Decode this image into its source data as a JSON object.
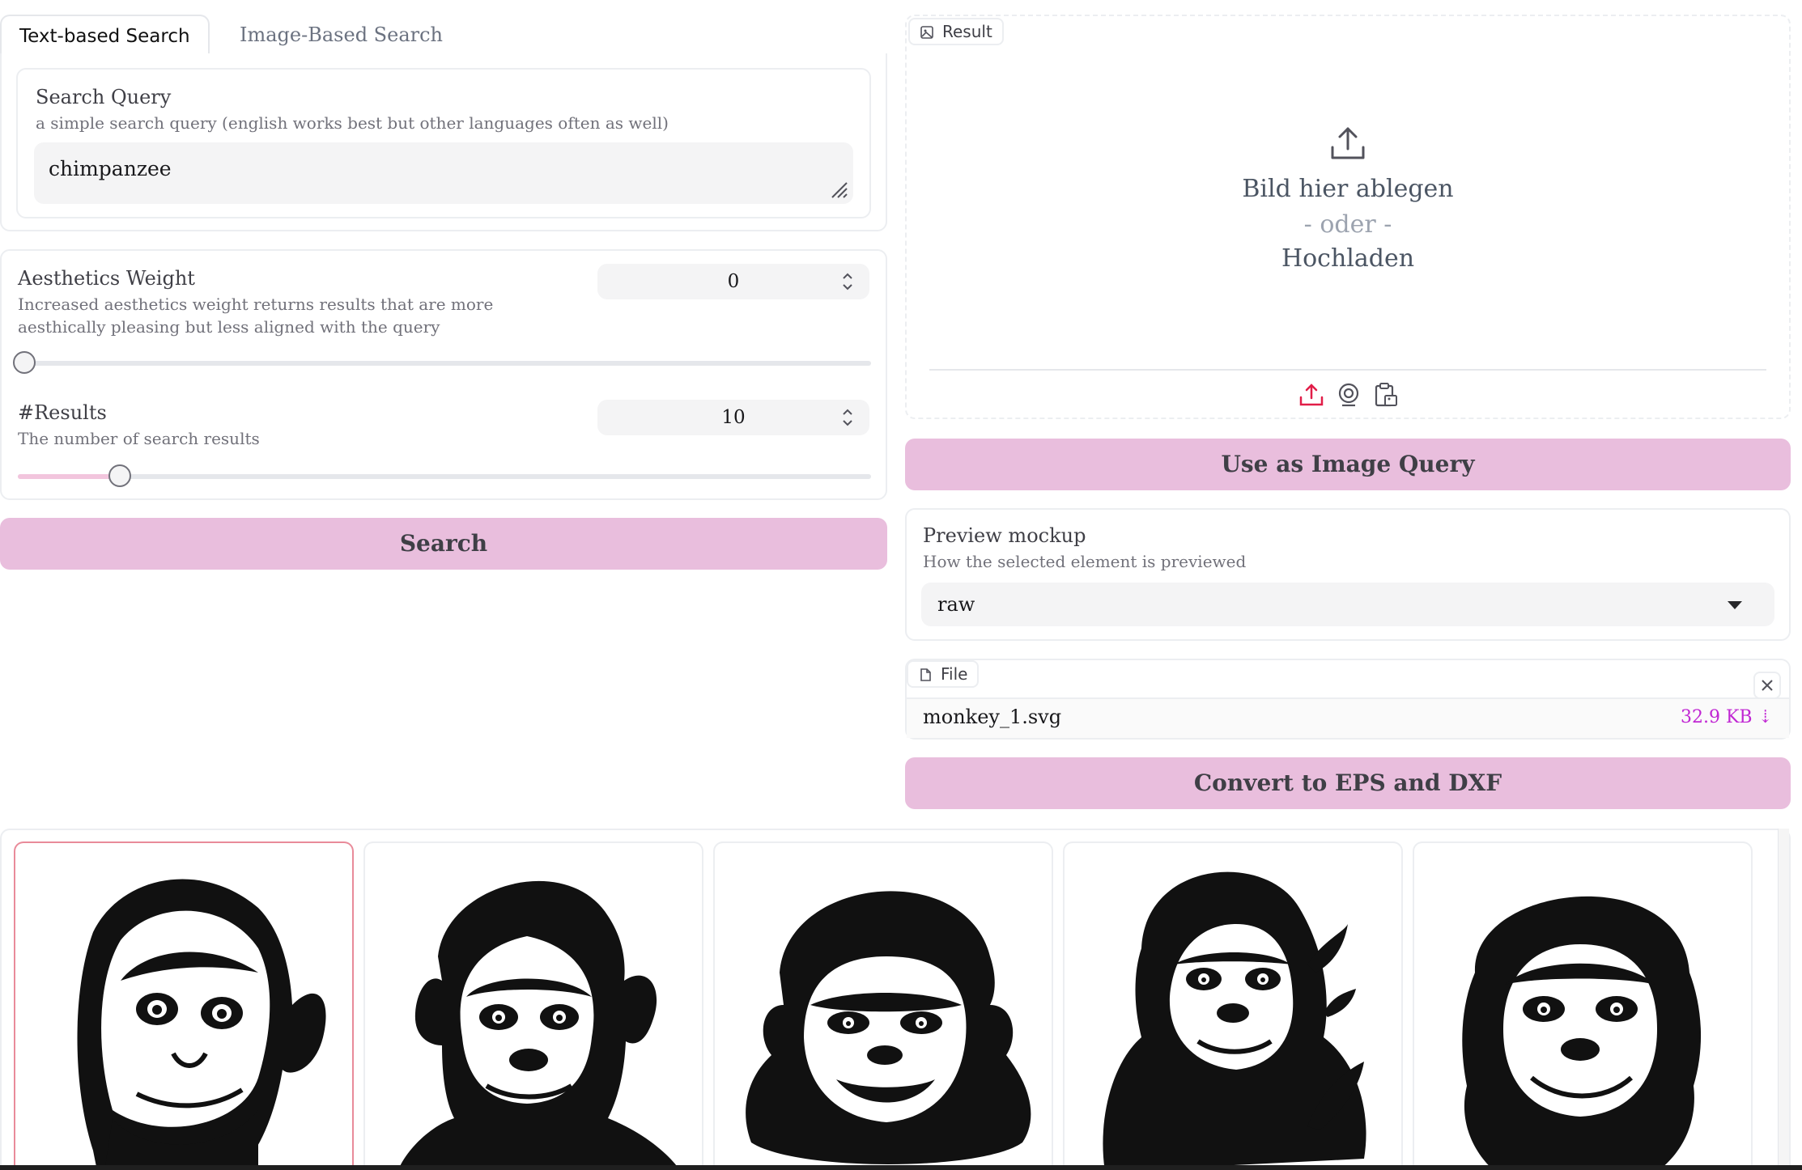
{
  "tabs": [
    {
      "label": "Text-based Search",
      "active": true
    },
    {
      "label": "Image-Based Search",
      "active": false
    }
  ],
  "search_query": {
    "label": "Search Query",
    "info": "a simple search query (english works best but other languages often as well)",
    "value": "chimpanzee"
  },
  "aesthetics": {
    "label": "Aesthetics Weight",
    "info": "Increased aesthetics weight returns results that are more aesthically pleasing but less aligned with the query",
    "value": "0",
    "fraction": 0.0
  },
  "results": {
    "label": "#Results",
    "info": "The number of search results",
    "value": "10",
    "fraction": 0.12
  },
  "search_button": {
    "label": "Search"
  },
  "result_upload": {
    "label": "Result",
    "drop_line1": "Bild hier ablegen",
    "drop_or": "- oder -",
    "drop_line2": "Hochladen",
    "sources": [
      "upload-icon",
      "webcam-icon",
      "clipboard-icon"
    ]
  },
  "image_query_button": {
    "label": "Use as Image Query"
  },
  "preview": {
    "label": "Preview mockup",
    "info": "How the selected element is previewed",
    "value": "raw"
  },
  "file": {
    "label": "File",
    "name": "monkey_1.svg",
    "size": "32.9 KB ⇣"
  },
  "convert_button": {
    "label": "Convert to EPS and DXF"
  },
  "colors": {
    "button": "#e9bedd",
    "accent": "#c026d3",
    "selected_border": "#e98b9a",
    "upload_icon": "#e11d48"
  },
  "gallery": [
    {
      "subject": "chimpanzee-illustration-1",
      "selected": true
    },
    {
      "subject": "chimpanzee-illustration-2",
      "selected": false
    },
    {
      "subject": "chimpanzee-illustration-3",
      "selected": false
    },
    {
      "subject": "chimpanzee-illustration-4",
      "selected": false
    },
    {
      "subject": "chimpanzee-illustration-5",
      "selected": false
    }
  ]
}
